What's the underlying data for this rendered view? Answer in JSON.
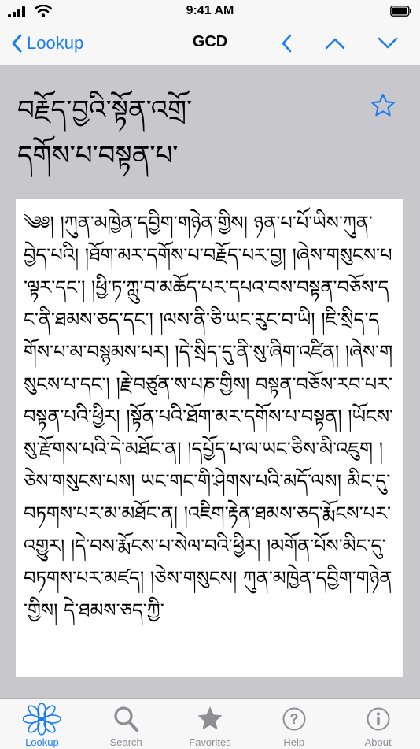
{
  "status": {
    "time": "9:41 AM"
  },
  "nav": {
    "back_label": "Lookup",
    "title": "GCD"
  },
  "entry": {
    "title": "བརྗོད་བྱའི་སྟོན་འགྲོ་\nདགོས་པ་བསྟན་པ་"
  },
  "definition": {
    "text": "༄༅། །ཀུན་མཁྱེན་དབྱིག་གཉེན་གྱིས། ཉན་པ་པོ་ཡིས་ཀུན་བྱེད་པའི། །ཐོག་མར་དགོས་པ་བརྗོད་པར་བྱ། །ཞེས་གསུངས་པ་ལྟར་དང་། །ཕྱི་ཏ་ཀླུ་བ་མཆོད་པར་དཔའ་བས་བསྟན་བཅོས་དང་ནི་ཐམས་ཅད་དང་། །ལས་ནི་ཅི་ཡང་རུང་བ་ཡི། །ཇི་སྲིད་དགོས་པ་མ་བསྙམས་པར། །དེ་སྲིད་དུ་ནི་སུ་ཞིག་འཛིན། །ཞེས་གསུངས་པ་དང་། །རྗེ་བཙུན་ས་པཎ་གྱིས། བསྟན་བཅོས་རབ་པར་བསྟན་པའི་ཕྱིར། །སྟོན་པའི་ཐོག་མར་དགོས་པ་བསྟན། །ཡོངས་སུ་རྫོགས་པའི་དེ་མཐོང་ན། །དཔྱོད་པ་ལ་ཡང་ཅིས་མི་འཇུག །ཅེས་གསུངས་པས། ཡང་གང་གི་ཤེགས་པའི་མདོ་ལས། མིང་དུ་བཏགས་པར་མ་མཐོང་ན། །འཇིག་རྟེན་ཐམས་ཅད་རྨོངས་པར་འགྱུར། །དེ་བས་རྨོངས་པ་སེལ་བའི་ཕྱིར། །མགོན་པོས་མིང་དུ་བཏགས་པར་མཛད། །ཅེས་གསུངས། ཀུན་མཁྱེན་དབྱིག་གཉེན་གྱིས། དེ་ཐམས་ཅད་ཀྱི་"
  },
  "tabs": [
    {
      "label": "Lookup",
      "icon": "lotus-icon",
      "active": true
    },
    {
      "label": "Search",
      "icon": "search-icon",
      "active": false
    },
    {
      "label": "Favorites",
      "icon": "star-icon",
      "active": false
    },
    {
      "label": "Help",
      "icon": "help-icon",
      "active": false
    },
    {
      "label": "About",
      "icon": "info-icon",
      "active": false
    }
  ],
  "colors": {
    "accent": "#1a7cf5",
    "inactive": "#8e8e93",
    "content_bg": "#c8c8cc"
  }
}
